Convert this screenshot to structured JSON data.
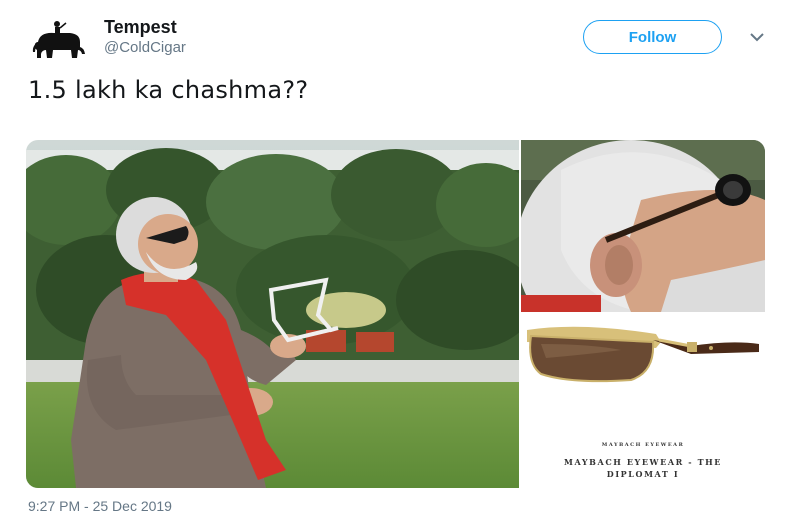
{
  "user": {
    "display_name": "Tempest",
    "handle": "@ColdCigar",
    "avatar_icon": "elephant-rider-icon"
  },
  "follow_label": "Follow",
  "menu_icon": "chevron-down-icon",
  "tweet": {
    "text": "1.5 lakh ka chashma??",
    "timestamp": "9:27 PM - 25 Dec 2019"
  },
  "media": {
    "product_brand": "MAYBACH EYEWEAR",
    "product_name_line1": "MAYBACH EYEWEAR - THE",
    "product_name_line2": "DIPLOMAT I"
  },
  "colors": {
    "accent": "#1da1f2",
    "text": "#14171a",
    "muted": "#657786"
  }
}
